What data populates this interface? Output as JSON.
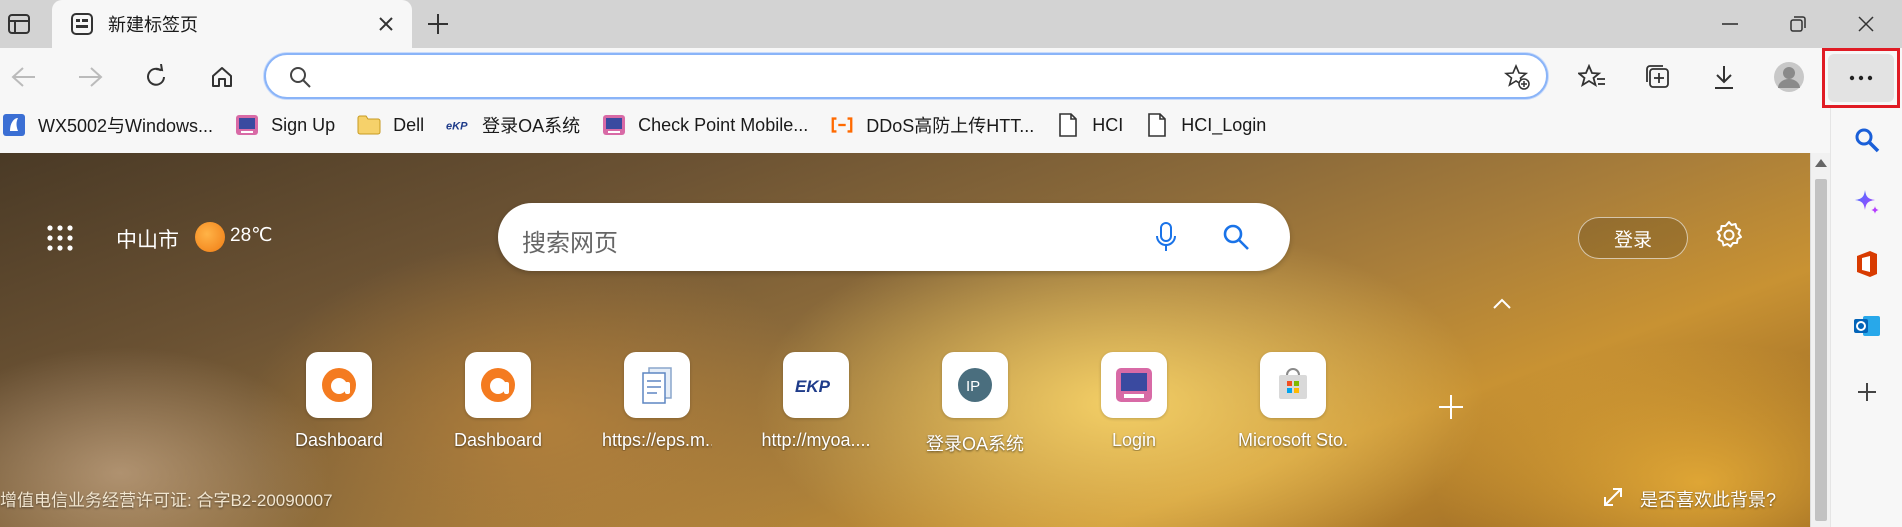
{
  "tab": {
    "title": "新建标签页"
  },
  "bookmarks": [
    {
      "label": "WX5002与Windows...",
      "icon": "wx-icon"
    },
    {
      "label": "Sign Up",
      "icon": "signup-icon"
    },
    {
      "label": "Dell",
      "icon": "folder-icon"
    },
    {
      "label": "登录OA系统",
      "icon": "ekp-icon"
    },
    {
      "label": "Check Point Mobile...",
      "icon": "checkpoint-icon"
    },
    {
      "label": "DDoS高防上传HTT...",
      "icon": "ddos-icon"
    },
    {
      "label": "HCI",
      "icon": "page-icon"
    },
    {
      "label": "HCI_Login",
      "icon": "page-icon"
    }
  ],
  "newtab": {
    "location": "中山市",
    "temperature": "28℃",
    "search_placeholder": "搜索网页",
    "login_label": "登录",
    "footer": "增值电信业务经营许可证: 合字B2-20090007",
    "bg_like": "是否喜欢此背景?"
  },
  "tiles": [
    {
      "label": "Dashboard"
    },
    {
      "label": "Dashboard"
    },
    {
      "label": "https://eps.m..."
    },
    {
      "label": "http://myoa...."
    },
    {
      "label": "登录OA系统"
    },
    {
      "label": "Login"
    },
    {
      "label": "Microsoft Sto..."
    }
  ],
  "colors": {
    "highlight": "#e01b24",
    "address_border": "#8ab4f8",
    "search_blue": "#1a73e8"
  }
}
